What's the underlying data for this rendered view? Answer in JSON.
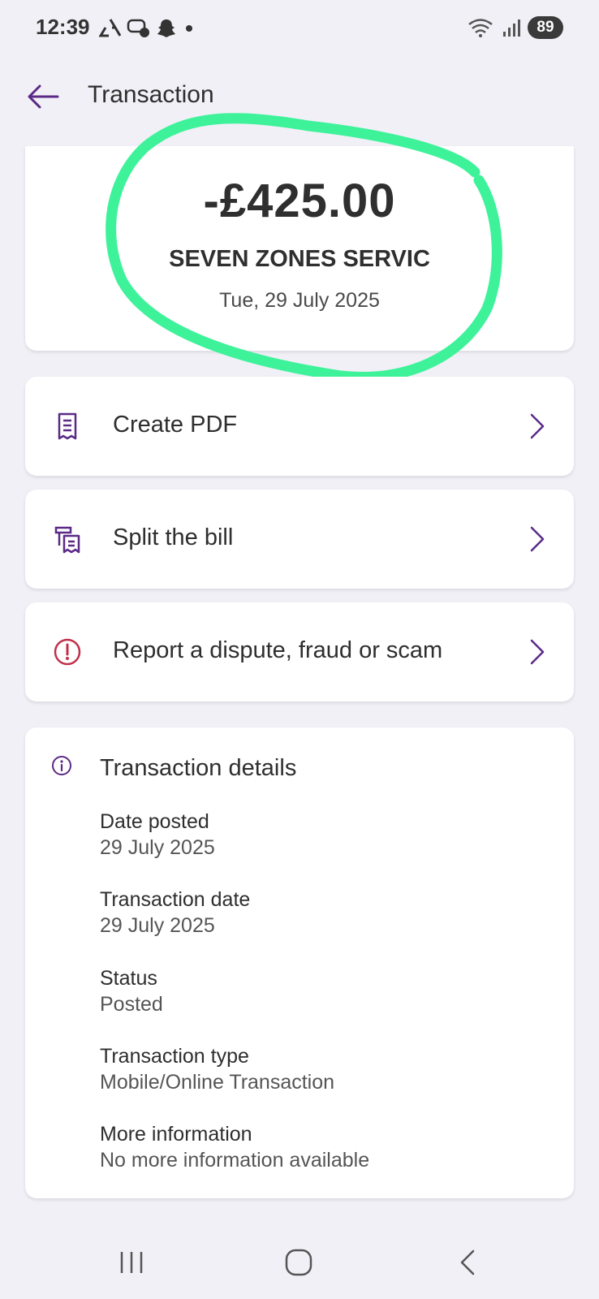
{
  "status_bar": {
    "time": "12:39",
    "battery": "89",
    "left_icons": [
      "recycle-icon",
      "chat-icon",
      "snapchat-icon",
      "dot-icon"
    ],
    "right_icons": [
      "wifi-icon",
      "signal-icon"
    ]
  },
  "header": {
    "title": "Transaction",
    "back_icon": "arrow-left-icon"
  },
  "transaction": {
    "amount": "-£425.00",
    "merchant": "SEVEN ZONES SERVIC",
    "date": "Tue, 29 July 2025"
  },
  "actions": [
    {
      "label": "Create PDF",
      "icon": "receipt-icon"
    },
    {
      "label": "Split the bill",
      "icon": "split-bill-icon"
    },
    {
      "label": "Report a dispute, fraud or scam",
      "icon": "alert-circle-icon"
    }
  ],
  "details": {
    "title": "Transaction details",
    "items": [
      {
        "label": "Date posted",
        "value": "29 July 2025"
      },
      {
        "label": "Transaction date",
        "value": "29 July 2025"
      },
      {
        "label": "Status",
        "value": "Posted"
      },
      {
        "label": "Transaction type",
        "value": "Mobile/Online Transaction"
      },
      {
        "label": "More information",
        "value": "No more information available"
      }
    ]
  },
  "colors": {
    "accent": "#5b2a86",
    "alert": "#c0304a",
    "highlight": "#3ef29a",
    "background": "#f1f0f7"
  }
}
